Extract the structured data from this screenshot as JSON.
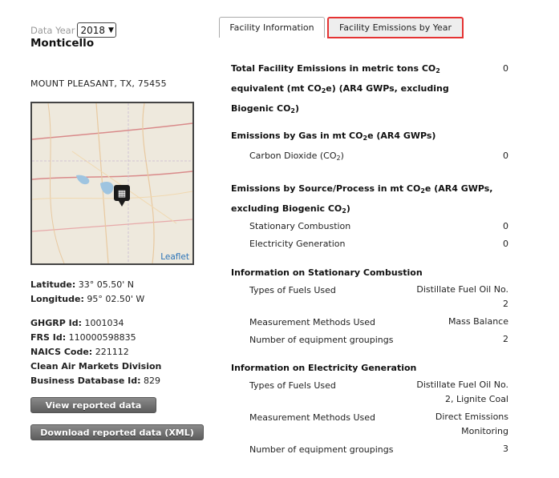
{
  "year": {
    "label": "Data Year",
    "selected": "2018"
  },
  "facility": {
    "name": "Monticello",
    "address": "MOUNT PLEASANT, TX, 75455"
  },
  "map": {
    "attribution": "Leaflet"
  },
  "details": {
    "latitude_label": "Latitude:",
    "latitude": "33° 05.50' N",
    "longitude_label": "Longitude:",
    "longitude": "95° 02.50' W",
    "ghgrp_label": "GHGRP Id:",
    "ghgrp": "1001034",
    "frs_label": "FRS Id:",
    "frs": "110000598835",
    "naics_label": "NAICS Code:",
    "naics": "221112",
    "camd_label_1": "Clean Air Markets Division",
    "camd_label_2": "Business Database Id:",
    "camd": "829"
  },
  "buttons": {
    "view": "View reported data",
    "download": "Download reported data (XML)"
  },
  "tabs": {
    "info": "Facility Information",
    "by_year": "Facility Emissions by Year"
  },
  "total": {
    "line1": "Total Facility Emissions in metric tons CO",
    "line2a": "equivalent (mt CO",
    "line2b": "e) (AR4 GWPs, excluding",
    "line3": "Biogenic CO",
    "value": "0"
  },
  "by_gas": {
    "heading_a": "Emissions by Gas in mt CO",
    "heading_b": "e (AR4 GWPs)",
    "co2_label_a": "Carbon Dioxide (CO",
    "co2_label_b": ")",
    "co2_value": "0"
  },
  "by_source": {
    "heading_a": "Emissions by Source/Process in mt CO",
    "heading_b": "e (AR4 GWPs,",
    "heading_c": "excluding Biogenic CO",
    "heading_d": ")",
    "stationary_label": "Stationary Combustion",
    "stationary_value": "0",
    "electricity_label": "Electricity Generation",
    "electricity_value": "0"
  },
  "stationary": {
    "heading": "Information on Stationary Combustion",
    "fuels_label": "Types of Fuels Used",
    "fuels_value_1": "Distillate Fuel Oil No.",
    "fuels_value_2": "2",
    "methods_label": "Measurement Methods Used",
    "methods_value": "Mass Balance",
    "groupings_label": "Number of equipment groupings",
    "groupings_value": "2"
  },
  "electricity": {
    "heading": "Information on Electricity Generation",
    "fuels_label": "Types of Fuels Used",
    "fuels_value_1": "Distillate Fuel Oil No.",
    "fuels_value_2": "2, Lignite Coal",
    "methods_label": "Measurement Methods Used",
    "methods_value_1": "Direct Emissions",
    "methods_value_2": "Monitoring",
    "groupings_label": "Number of equipment groupings",
    "groupings_value": "3"
  },
  "colors": {
    "tab_highlight": "#e53333",
    "link": "#2a73b8",
    "button": "#6e6e6e"
  },
  "icons": {
    "map_marker": "factory-marker-icon",
    "select": "chevron-down-icon"
  }
}
